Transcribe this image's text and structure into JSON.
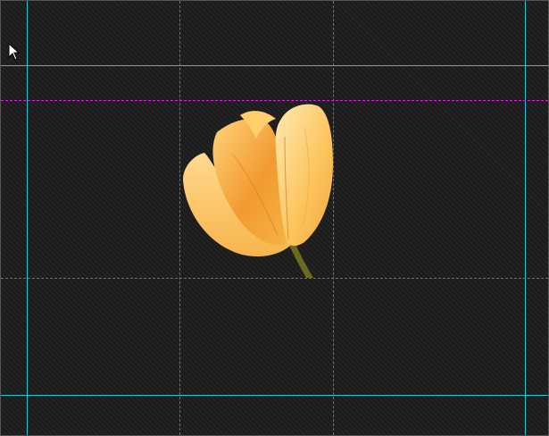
{
  "canvas": {
    "background": "#1f1f1f",
    "border_color": "#555555",
    "guide_colors": {
      "margin_guide": "#23c9d6",
      "grid_guide": "#e01ee8"
    }
  },
  "image": {
    "subject_icon": "tulip-image",
    "petal_colors": [
      "#f7b23a",
      "#ffd98a",
      "#f08a1a"
    ],
    "stem_color": "#6d6a1e"
  },
  "cursor": {
    "icon": "arrow-pointer-icon"
  }
}
